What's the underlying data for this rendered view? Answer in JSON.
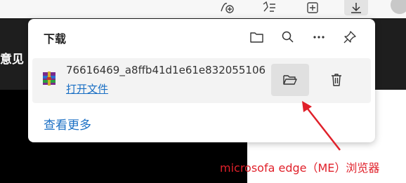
{
  "popup": {
    "title": "下载",
    "header_icons": [
      "folder-icon",
      "search-icon",
      "more-icon",
      "pin-icon"
    ]
  },
  "download_item": {
    "file_name": "76616469_a8ffb41d1e61e832055106",
    "open_file_label": "打开文件"
  },
  "see_more_label": "查看更多",
  "background": {
    "partial_text": "意见"
  },
  "annotation": {
    "text": "microsofa edge（ME）浏览器",
    "color": "#e0202a"
  },
  "colors": {
    "accent_link": "#1a6fc4"
  }
}
